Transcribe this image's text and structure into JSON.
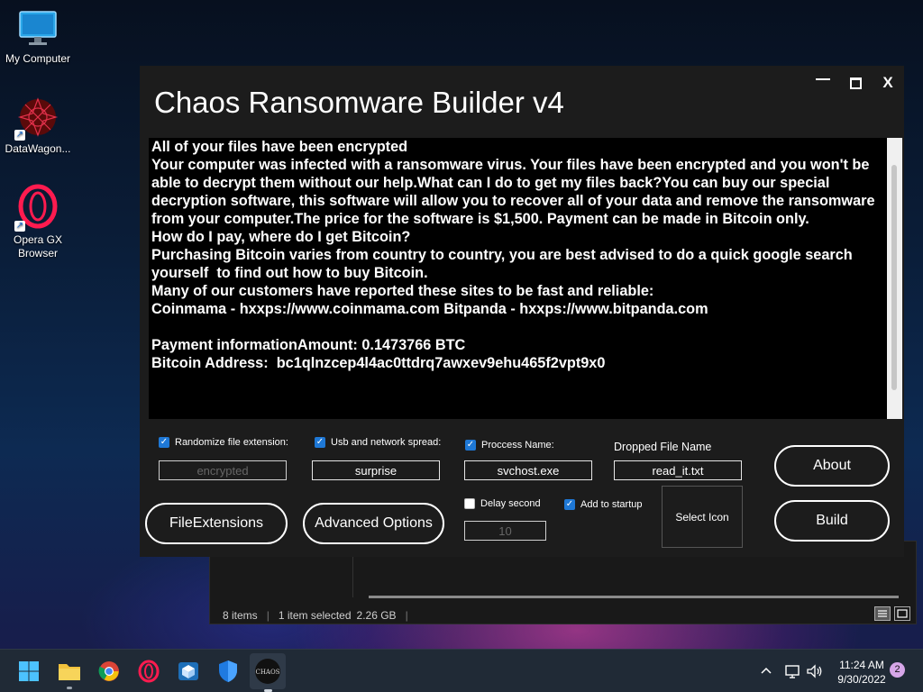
{
  "desktop": {
    "icons": [
      {
        "label": "My Computer",
        "icon": "monitor-icon"
      },
      {
        "label": "DataWagon...",
        "icon": "datawagon-icon"
      },
      {
        "label": "Opera GX Browser",
        "icon": "opera-gx-icon"
      }
    ]
  },
  "explorer": {
    "items_count": "8 items",
    "selection": "1 item selected",
    "size": "2.26 GB"
  },
  "builder": {
    "title": "Chaos Ransomware Builder v4",
    "controls": {
      "minimize": "—",
      "maximize": "▢",
      "close": "X"
    },
    "note_text": "All of your files have been encrypted\nYour computer was infected with a ransomware virus. Your files have been encrypted and you won't be able to decrypt them without our help.What can I do to get my files back?You can buy our special decryption software, this software will allow you to recover all of your data and remove the ransomware from your computer.The price for the software is $1,500. Payment can be made in Bitcoin only.\nHow do I pay, where do I get Bitcoin?\nPurchasing Bitcoin varies from country to country, you are best advised to do a quick google search yourself  to find out how to buy Bitcoin.\nMany of our customers have reported these sites to be fast and reliable:\nCoinmama - hxxps://www.coinmama.com Bitpanda - hxxps://www.bitpanda.com\n\nPayment informationAmount: 0.1473766 BTC\nBitcoin Address:  bc1qlnzcep4l4ac0ttdrq7awxev9ehu465f2vpt9x0",
    "options": {
      "randomize_ext": {
        "label": "Randomize file extension:",
        "checked": true,
        "value": "encrypted"
      },
      "usb_spread": {
        "label": "Usb and network spread:",
        "checked": true,
        "value": "surprise"
      },
      "process_name": {
        "label": "Proccess Name:",
        "checked": true,
        "value": "svchost.exe"
      },
      "dropped_file": {
        "label": "Dropped File Name",
        "value": "read_it.txt"
      },
      "delay": {
        "label": "Delay second",
        "checked": false,
        "value": "10"
      },
      "startup": {
        "label": "Add to startup",
        "checked": true
      }
    },
    "buttons": {
      "file_extensions": "FileExtensions",
      "advanced_options": "Advanced Options",
      "select_icon": "Select Icon",
      "about": "About",
      "build": "Build"
    }
  },
  "taskbar": {
    "apps": [
      "start-icon",
      "file-explorer-icon",
      "chrome-icon",
      "opera-icon",
      "package-icon",
      "defender-icon",
      "chaos-icon"
    ],
    "time": "11:24 AM",
    "date": "9/30/2022",
    "notifications": "2"
  }
}
